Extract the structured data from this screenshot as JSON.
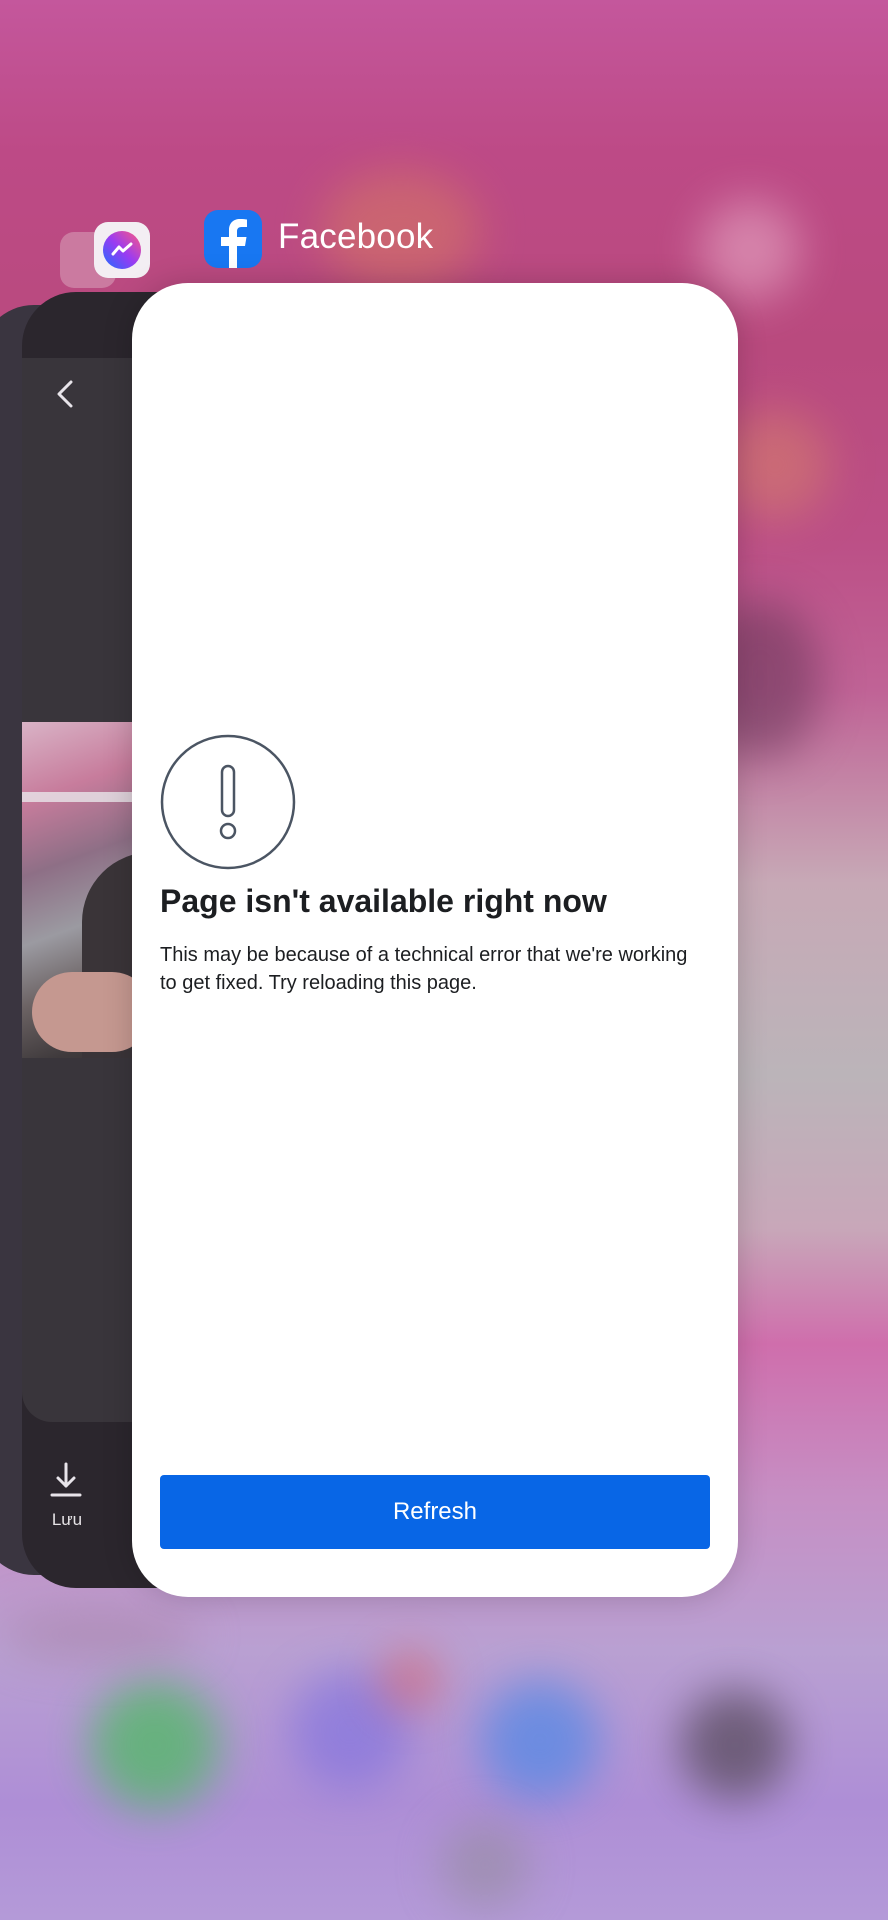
{
  "switcher": {
    "app_title": "Facebook",
    "icons": [
      "photos-icon",
      "messenger-icon",
      "facebook-icon"
    ]
  },
  "background_card": {
    "save_label": "Lưu",
    "icons": [
      "chevron-left-icon",
      "download-icon"
    ]
  },
  "error_page": {
    "title": "Page isn't available right now",
    "message": "This may be because of a technical error that we're working to get fixed. Try reloading this page.",
    "refresh_label": "Refresh",
    "icon": "alert-circle-icon"
  },
  "colors": {
    "accent": "#0866e6",
    "brand": "#1877f2",
    "text": "#1c1e21"
  }
}
